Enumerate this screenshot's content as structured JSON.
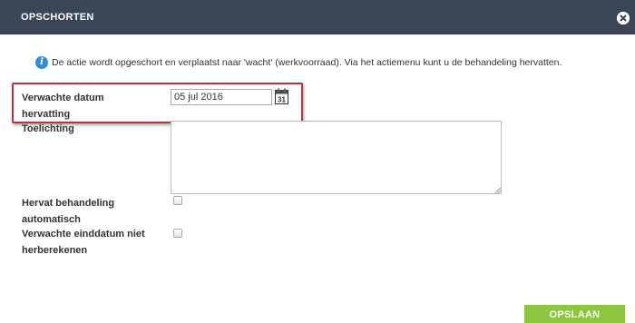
{
  "dialog": {
    "title": "OPSCHORTEN",
    "close_icon": "close-circle-icon",
    "info": {
      "icon": "info-icon",
      "text": "De actie wordt opgeschort en verplaatst naar 'wacht' (werkvoorraad). Via het actiemenu kunt u de behandeling hervatten."
    },
    "fields": {
      "expected_date": {
        "label_line1": "Verwachte datum",
        "label_line2": "hervatting",
        "value": "05 jul 2016",
        "calendar_icon": "calendar-icon",
        "calendar_day": "31"
      },
      "explanation": {
        "label": "Toelichting",
        "value": ""
      },
      "resume_auto": {
        "label_line1": "Hervat behandeling",
        "label_line2": "automatisch",
        "checked": false
      },
      "no_recalc": {
        "label_line1": "Verwachte einddatum niet",
        "label_line2": "herberekenen",
        "checked": false
      }
    },
    "save_label": "OPSLAAN",
    "colors": {
      "header_bg": "#3a4556",
      "highlight_border": "#b9343a",
      "save_bg": "#8dc63f",
      "info_icon": "#2f8fd0"
    }
  }
}
